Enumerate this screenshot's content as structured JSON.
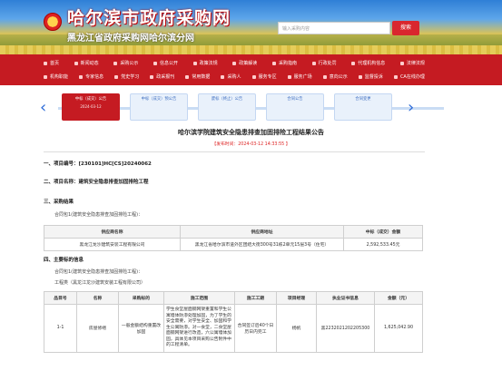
{
  "header": {
    "site_title": "哈尔滨市政府采购网",
    "site_subtitle": "黑龙江省政府采购网哈尔滨分网",
    "search_placeholder": "输入采购内容",
    "search_button": "搜索"
  },
  "nav": {
    "row1": [
      "首页",
      "新闻动态",
      "采购公示",
      "信息公开",
      "政策法规",
      "政策解读",
      "采购指南",
      "行政处罚",
      "代理机构信息",
      "法律法规"
    ],
    "row2": [
      "机构职能",
      "专家信息",
      "党史学习",
      "政采报刊",
      "常用数据",
      "采购人",
      "服务专区",
      "服务广场",
      "意向公示",
      "监督投诉",
      "CA在线办理"
    ]
  },
  "timeline": {
    "cards": [
      {
        "label": "中标（成交）公告",
        "date": "2024-03-12",
        "active": true
      },
      {
        "label": "中标（成交）预公告",
        "date": "",
        "active": false
      },
      {
        "label": "废标（终止）公告",
        "date": "",
        "active": false
      },
      {
        "label": "合同公告",
        "date": "",
        "active": false
      },
      {
        "label": "合同变更",
        "date": "",
        "active": false
      }
    ]
  },
  "notice": {
    "title": "哈尔滨学院建筑安全隐患排查加固排险工程结果公告",
    "meta": "【发布时间：2024-03-12 14:33:55 】",
    "project_no": "一、项目编号：[230101]HC[CS]20240062",
    "project_name": "二、项目名称：建筑安全隐患排查加固排险工程",
    "result_title": "三、采购结果",
    "contract_pkg": "合同包1(建筑安全隐患排查加固排险工程)：",
    "main_info_title": "四、主要标的信息",
    "contract_pkg2": "合同包1(建筑安全隐患排查加固排险工程)：",
    "engineering": "工程类（黑龙江龙沙建筑安装工程有限公司）"
  },
  "result_table": {
    "headers": [
      "供应商名称",
      "供应商地址",
      "中标（成交）金额"
    ],
    "rows": [
      [
        "黑龙江龙沙建筑安装工程有限公司",
        "黑龙江省哈尔滨市道外区团结大街300号31栋2单元15层3号（住宅）",
        "2,592,533.45元"
      ]
    ]
  },
  "item_table": {
    "headers": [
      "品目号",
      "名称",
      "采购标的",
      "施工范围",
      "施工工期",
      "项目经理",
      "执业证书信息",
      "金额（元）"
    ],
    "rows": [
      [
        "1-1",
        "房屋修缮",
        "一般金额结构重置改加固",
        "学生食堂屋面钢网架重置和学生公寓墙体防渗处理加固，为了学生的安全需要，对学生安全、加固和学生公寓防渗。对一食堂，二食堂屋面钢网架进行改造，六公寓墙体加固，具体见本项目采购公告附件中的工程清单。",
        "合同签订后40个日历日内完工",
        "杨帆",
        "黑2232021202205300",
        "1,625,042.90"
      ]
    ]
  }
}
